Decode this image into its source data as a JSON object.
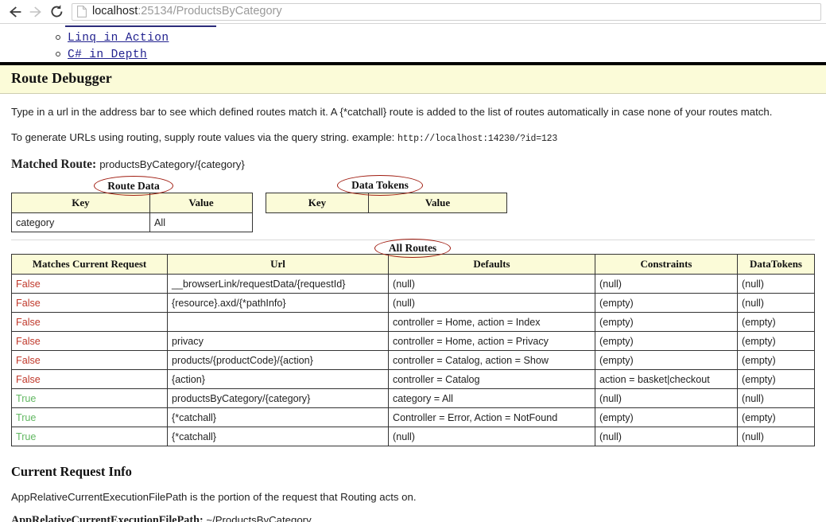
{
  "browser": {
    "back_icon": "back-arrow-icon",
    "forward_icon": "forward-arrow-icon",
    "reload_icon": "reload-icon",
    "favicon": "page-document-icon",
    "url_host": "localhost",
    "url_path": ":25134/ProductsByCategory",
    "url_full": "localhost:25134/ProductsByCategory"
  },
  "top_list": {
    "items": [
      {
        "label": "Linq in Action"
      },
      {
        "label": "C# in Depth"
      }
    ]
  },
  "banner": {
    "title": "Route Debugger",
    "bg_color": "#fbfbd8"
  },
  "intro": {
    "paragraph1": "Type in a url in the address bar to see which defined routes match it. A {*catchall} route is added to the list of routes automatically in case none of your routes match.",
    "paragraph2_prefix": "To generate URLs using routing, supply route values via the query string. example:",
    "paragraph2_example": "http://localhost:14230/?id=123"
  },
  "matched_route": {
    "label": "Matched Route:",
    "value": "productsByCategory/{category}"
  },
  "annotations": {
    "route_data": "Route Data",
    "data_tokens": "Data Tokens",
    "all_routes": "All Routes",
    "color": "#a01c10"
  },
  "route_data_table": {
    "headers": [
      "Key",
      "Value"
    ],
    "rows": [
      [
        "category",
        "All"
      ]
    ]
  },
  "data_tokens_table": {
    "headers": [
      "Key",
      "Value"
    ],
    "rows": []
  },
  "all_routes_table": {
    "headers": [
      "Matches Current Request",
      "Url",
      "Defaults",
      "Constraints",
      "DataTokens"
    ],
    "rows": [
      {
        "matches": "False",
        "url": "__browserLink/requestData/{requestId}",
        "defaults": "(null)",
        "constraints": "(null)",
        "datatokens": "(null)"
      },
      {
        "matches": "False",
        "url": "{resource}.axd/{*pathInfo}",
        "defaults": "(null)",
        "constraints": "(empty)",
        "datatokens": "(null)"
      },
      {
        "matches": "False",
        "url": "",
        "defaults": "controller = Home, action = Index",
        "constraints": "(empty)",
        "datatokens": "(empty)"
      },
      {
        "matches": "False",
        "url": "privacy",
        "defaults": "controller = Home, action = Privacy",
        "constraints": "(empty)",
        "datatokens": "(empty)"
      },
      {
        "matches": "False",
        "url": "products/{productCode}/{action}",
        "defaults": "controller = Catalog, action = Show",
        "constraints": "(empty)",
        "datatokens": "(empty)"
      },
      {
        "matches": "False",
        "url": "{action}",
        "defaults": "controller = Catalog",
        "constraints": "action = basket|checkout",
        "datatokens": "(empty)"
      },
      {
        "matches": "True",
        "url": "productsByCategory/{category}",
        "defaults": "category = All",
        "constraints": "(null)",
        "datatokens": "(null)"
      },
      {
        "matches": "True",
        "url": "{*catchall}",
        "defaults": "Controller = Error, Action = NotFound",
        "constraints": "(empty)",
        "datatokens": "(empty)"
      },
      {
        "matches": "True",
        "url": "{*catchall}",
        "defaults": "(null)",
        "constraints": "(null)",
        "datatokens": "(null)"
      }
    ]
  },
  "current_request_info": {
    "heading": "Current Request Info",
    "description": "AppRelativeCurrentExecutionFilePath is the portion of the request that Routing acts on.",
    "path_label": "AppRelativeCurrentExecutionFilePath:",
    "path_value": "~/ProductsByCategory"
  },
  "colors": {
    "true": "#63b863",
    "false": "#c0392b",
    "header_bg": "#fbfbd8",
    "border": "#333333"
  }
}
